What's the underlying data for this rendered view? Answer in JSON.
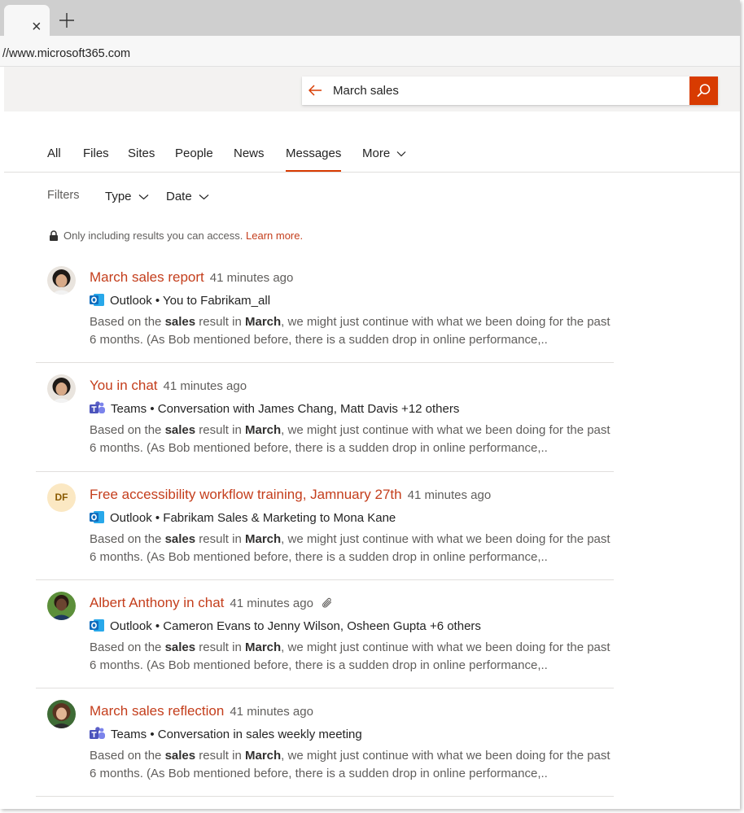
{
  "browser": {
    "tab_close": "×",
    "url": "//www.microsoft365.com"
  },
  "search": {
    "query": "March sales"
  },
  "nav": {
    "tabs": [
      "All",
      "Files",
      "Sites",
      "People",
      "News",
      "Messages",
      "More"
    ],
    "active": "Messages"
  },
  "filters": {
    "label": "Filters",
    "type_label": "Type",
    "date_label": "Date"
  },
  "notice": {
    "text": "Only including results you can access.",
    "link": "Learn more."
  },
  "results": [
    {
      "title": "March sales report",
      "time": "41 minutes ago",
      "app": "outlook",
      "source": "Outlook • You to Fabrikam_all",
      "body_pre": "Based on the ",
      "body_b1": "sales",
      "body_mid": " result in ",
      "body_b2": "March",
      "body_post": ", we might just continue with what we been doing for the past 6 months. (As Bob mentioned before, there is a sudden drop in online performance,..",
      "has_attachment": false
    },
    {
      "title": "You in chat",
      "time": "41 minutes ago",
      "app": "teams",
      "source": "Teams • Conversation with James Chang, Matt Davis +12 others",
      "body_pre": "Based on the ",
      "body_b1": "sales",
      "body_mid": " result in ",
      "body_b2": "March",
      "body_post": ", we might just continue with what we been doing for the past 6 months. (As Bob mentioned before, there is a sudden drop in online performance,..",
      "has_attachment": false
    },
    {
      "title": "Free accessibility workflow training, Jamnuary 27th",
      "time": "41 minutes ago",
      "app": "outlook",
      "initials": "DF",
      "source": "Outlook • Fabrikam Sales & Marketing to Mona Kane",
      "body_pre": "Based on the ",
      "body_b1": "sales",
      "body_mid": " result in ",
      "body_b2": "March",
      "body_post": ", we might just continue with what we been doing for the past 6 months. (As Bob mentioned before, there is a sudden drop in online performance,..",
      "has_attachment": false
    },
    {
      "title": "Albert Anthony in chat",
      "time": "41 minutes ago",
      "app": "outlook",
      "source": "Outlook • Cameron Evans to Jenny Wilson, Osheen Gupta +6 others",
      "body_pre": "Based on the ",
      "body_b1": "sales",
      "body_mid": " result in ",
      "body_b2": "March",
      "body_post": ", we might just continue with what we been doing for the past 6 months. (As Bob mentioned before, there is a sudden drop in online performance,..",
      "has_attachment": true
    },
    {
      "title": "March sales reflection",
      "time": "41 minutes ago",
      "app": "teams",
      "source": "Teams • Conversation in sales weekly meeting",
      "body_pre": "Based on the ",
      "body_b1": "sales",
      "body_mid": " result in ",
      "body_b2": "March",
      "body_post": ", we might just continue with what we been doing for the past 6 months. (As Bob mentioned before, there is a sudden drop in online performance,..",
      "has_attachment": false
    }
  ],
  "colors": {
    "accent": "#d83b01",
    "title_link": "#c43e1c",
    "outlook_blue": "#0f6cbd",
    "teams_purple": "#5b5fc7"
  }
}
